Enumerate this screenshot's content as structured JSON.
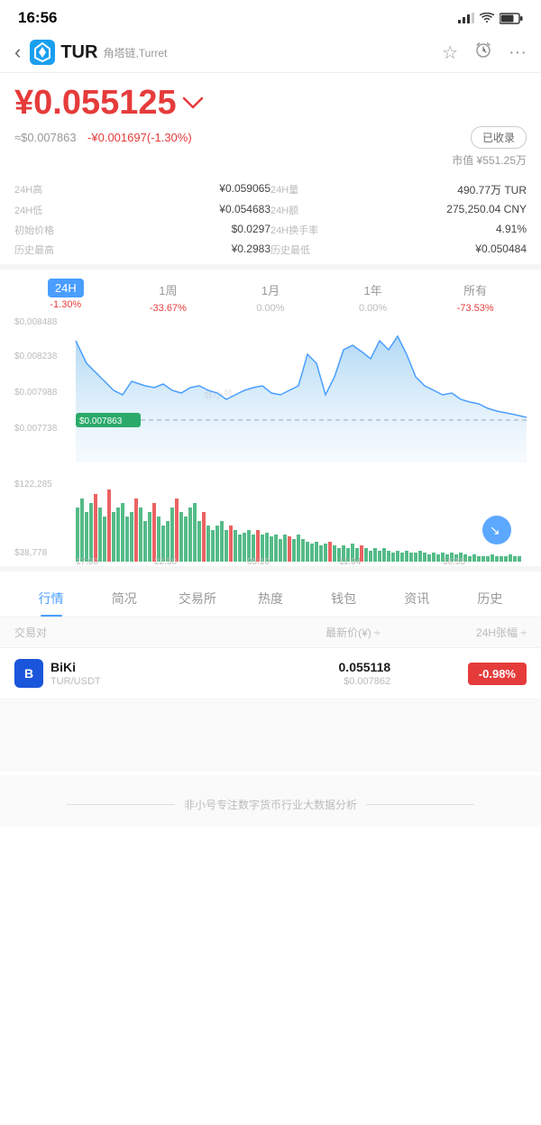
{
  "statusBar": {
    "time": "16:56"
  },
  "header": {
    "ticker": "TUR",
    "subtitle": "角塔链,Turret",
    "back": "‹",
    "star": "☆",
    "alarm": "⏰",
    "more": "···"
  },
  "price": {
    "main": "¥0.055125",
    "arrow": "↘",
    "usd": "≈$0.007863",
    "change": "-¥0.001697(-1.30%)",
    "collected": "已收录",
    "marketCapLabel": "市值",
    "marketCap": "¥551.25万"
  },
  "stats": [
    {
      "label": "24H高",
      "value": "¥0.059065"
    },
    {
      "label": "24H量",
      "value": "490.77万 TUR"
    },
    {
      "label": "24H低",
      "value": "¥0.054683"
    },
    {
      "label": "24H额",
      "value": "275,250.04 CNY"
    },
    {
      "label": "初始价格",
      "value": "$0.0297"
    },
    {
      "label": "24H换手率",
      "value": "4.91%"
    },
    {
      "label": "历史最高",
      "value": "¥0.2983"
    },
    {
      "label": "历史最低",
      "value": "¥0.050484"
    }
  ],
  "chartTabs": [
    {
      "label": "24H",
      "pct": "-1.30%",
      "active": true,
      "pctClass": "pct-red"
    },
    {
      "label": "1周",
      "pct": "-33.67%",
      "active": false,
      "pctClass": "pct-red"
    },
    {
      "label": "1月",
      "pct": "0.00%",
      "active": false,
      "pctClass": "pct-gray"
    },
    {
      "label": "1年",
      "pct": "0.00%",
      "active": false,
      "pctClass": "pct-gray"
    },
    {
      "label": "所有",
      "pct": "-73.53%",
      "active": false,
      "pctClass": "pct-red"
    }
  ],
  "chartData": {
    "priceLabels": [
      "$0.008488",
      "$0.008238",
      "$0.007988",
      "$0.007863",
      "$0.007738"
    ],
    "currentPrice": "$0.007863",
    "timeLabels": [
      "17:00",
      "22:50",
      "05:10",
      "11:04",
      "16:55"
    ],
    "volLabels": [
      "$122,285",
      "$38,778"
    ]
  },
  "bottomTabs": [
    {
      "label": "行情",
      "active": true
    },
    {
      "label": "简况",
      "active": false
    },
    {
      "label": "交易所",
      "active": false
    },
    {
      "label": "热度",
      "active": false
    },
    {
      "label": "钱包",
      "active": false
    },
    {
      "label": "资讯",
      "active": false
    },
    {
      "label": "历史",
      "active": false
    }
  ],
  "tableHeader": {
    "col1": "交易对",
    "col2": "最新价(¥) ÷",
    "col3": "24H张幅 ÷"
  },
  "exchanges": [
    {
      "logo": "B",
      "logoColor": "#1a56db",
      "name": "BiKi",
      "pair": "TUR/USDT",
      "price": "0.055118",
      "priceUsd": "$0.007862",
      "change": "-0.98%",
      "changeColor": "#e63b3b"
    }
  ],
  "footer": {
    "text": "非小号专注数字货币行业大数据分析"
  }
}
